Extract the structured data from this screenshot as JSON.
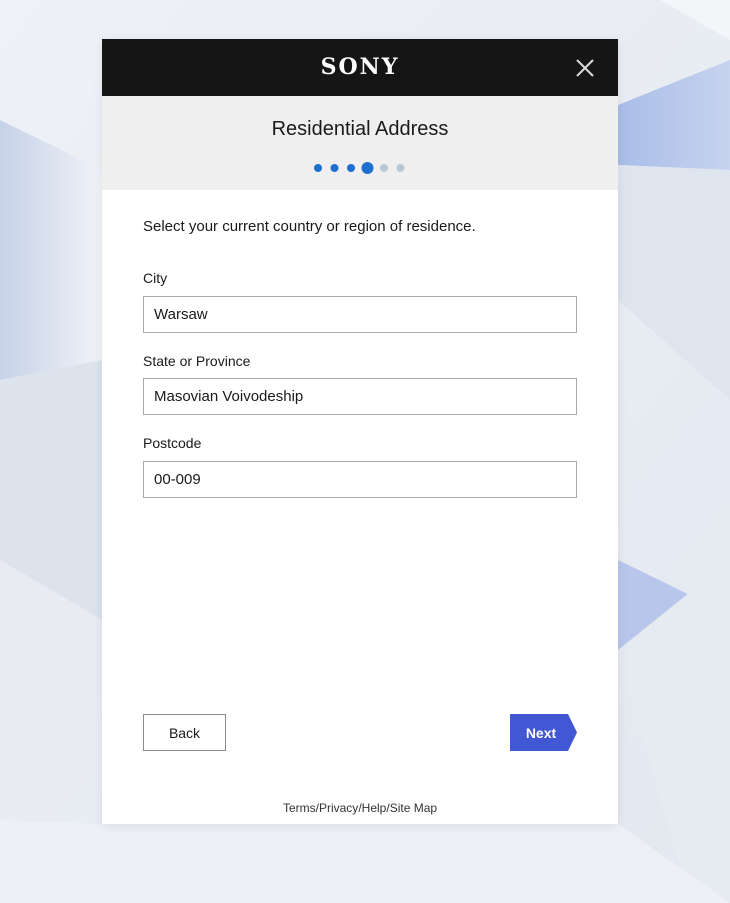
{
  "brand": "SONY",
  "header": {
    "title": "Residential Address"
  },
  "progress": {
    "total_steps": 6,
    "current_step": 4
  },
  "form": {
    "intro": "Select your current country or region of residence.",
    "city": {
      "label": "City",
      "value": "Warsaw"
    },
    "state": {
      "label": "State or Province",
      "value": "Masovian Voivodeship"
    },
    "postcode": {
      "label": "Postcode",
      "value": "00-009"
    }
  },
  "actions": {
    "back_label": "Back",
    "next_label": "Next"
  },
  "footer": {
    "terms": "Terms",
    "privacy": "Privacy",
    "help": "Help",
    "sitemap": "Site Map",
    "separator": "/"
  },
  "colors": {
    "topbar": "#151515",
    "header_bg": "#efefef",
    "accent": "#4157d3",
    "step_active": "#1f6fd0",
    "step_inactive": "#b7c9d8"
  }
}
